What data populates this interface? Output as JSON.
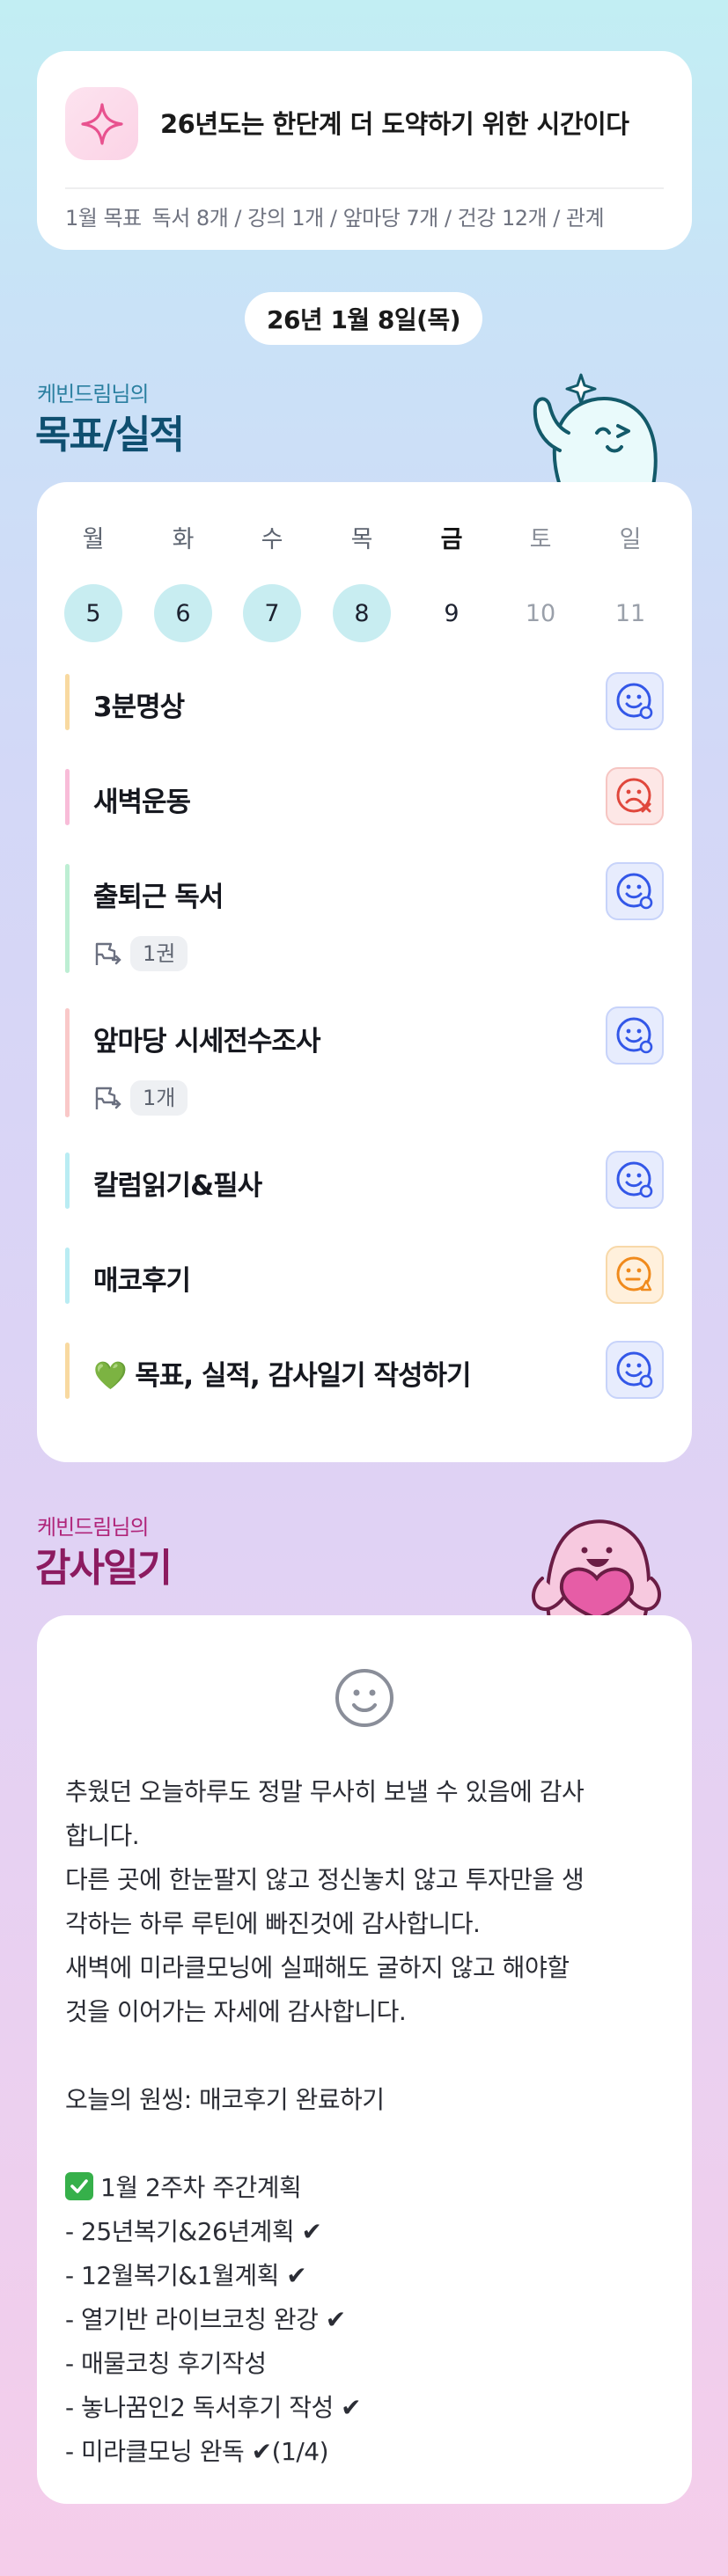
{
  "goal_card": {
    "title": "26년도는 한단계 더 도약하기 위한 시간이다",
    "month_label": "1월 목표",
    "goals_text": "독서 8개 / 강의 1개 / 앞마당 7개 / 건강 12개 / 관계",
    "icon": "sparkle-icon"
  },
  "date_label": "26년 1월 8일(목)",
  "goals_section": {
    "owner": "케빈드림님의",
    "title": "목표/실적"
  },
  "week": {
    "days": [
      {
        "name": "월",
        "num": "5",
        "state": "done"
      },
      {
        "name": "화",
        "num": "6",
        "state": "done"
      },
      {
        "name": "수",
        "num": "7",
        "state": "done"
      },
      {
        "name": "목",
        "num": "8",
        "state": "done"
      },
      {
        "name": "금",
        "num": "9",
        "state": "today"
      },
      {
        "name": "토",
        "num": "10",
        "state": "future"
      },
      {
        "name": "일",
        "num": "11",
        "state": "future"
      }
    ]
  },
  "tasks": [
    {
      "title": "3분명상",
      "bar_color": "#f8d9a0",
      "status": "smile-blue",
      "meta": null
    },
    {
      "title": "새벽운동",
      "bar_color": "#f8bcd8",
      "status": "frown-red",
      "meta": null
    },
    {
      "title": "출퇴근 독서",
      "bar_color": "#bdeed3",
      "status": "smile-blue",
      "meta": "1권"
    },
    {
      "title": "앞마당 시세전수조사",
      "bar_color": "#f9c8c8",
      "status": "smile-blue",
      "meta": "1개"
    },
    {
      "title": "칼럼읽기&필사",
      "bar_color": "#b9ecf3",
      "status": "smile-blue",
      "meta": null
    },
    {
      "title": "매코후기",
      "bar_color": "#b9ecf3",
      "status": "neutral-orange",
      "meta": null
    },
    {
      "title": "💚 목표, 실적, 감사일기 작성하기",
      "bar_color": "#f8d9a0",
      "status": "smile-blue",
      "meta": null
    }
  ],
  "gratitude_section": {
    "owner": "케빈드림님의",
    "title": "감사일기"
  },
  "gratitude": {
    "lines": [
      "추웠던 오늘하루도 정말 무사히 보낼 수 있음에 감사",
      "합니다.",
      "다른 곳에 한눈팔지 않고 정신놓치 않고 투자만을 생",
      "각하는 하루 루틴에 빠진것에 감사합니다.",
      "새벽에 미라클모닝에 실패해도 굴하지 않고 해야할",
      "것을 이어가는 자세에 감사합니다.",
      "",
      "오늘의 원씽: 매코후기 완료하기",
      "",
      "1월 2주차 주간계획",
      "- 25년복기&26년계획 ✔",
      "- 12월복기&1월계획 ✔",
      "- 열기반 라이브코칭 완강 ✔",
      "- 매물코칭 후기작성",
      "- 놓나꿈인2 독서후기 작성 ✔",
      "- 미라클모닝 완독 ✔(1/4)"
    ]
  }
}
